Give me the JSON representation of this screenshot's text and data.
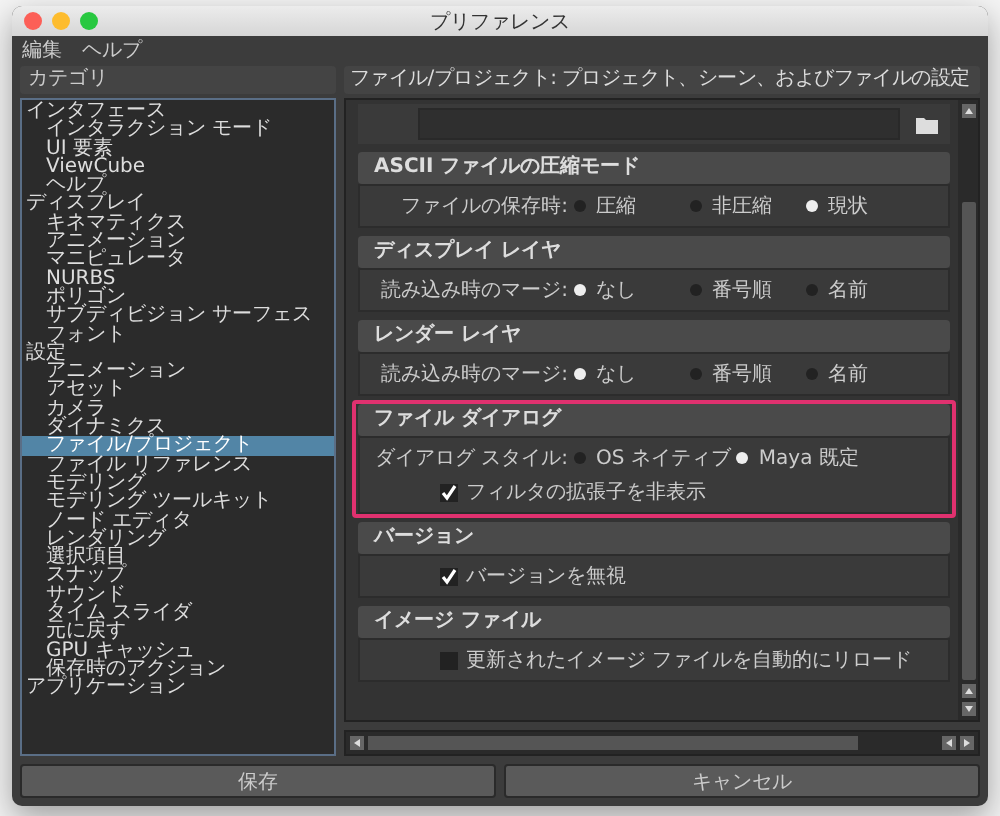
{
  "window": {
    "title": "プリファレンス"
  },
  "menu": [
    "編集",
    "ヘルプ"
  ],
  "categories_header": "カテゴリ",
  "categories": [
    {
      "label": "インタフェース",
      "selected": false,
      "children": [
        {
          "label": "インタラクション モード",
          "selected": false
        },
        {
          "label": "UI 要素",
          "selected": false
        },
        {
          "label": "ViewCube",
          "selected": false
        },
        {
          "label": "ヘルプ",
          "selected": false
        }
      ]
    },
    {
      "label": "ディスプレイ",
      "selected": false,
      "children": [
        {
          "label": "キネマティクス",
          "selected": false
        },
        {
          "label": "アニメーション",
          "selected": false
        },
        {
          "label": "マニピュレータ",
          "selected": false
        },
        {
          "label": "NURBS",
          "selected": false
        },
        {
          "label": "ポリゴン",
          "selected": false
        },
        {
          "label": "サブディビジョン サーフェス",
          "selected": false
        },
        {
          "label": "フォント",
          "selected": false
        }
      ]
    },
    {
      "label": "設定",
      "selected": false,
      "children": [
        {
          "label": "アニメーション",
          "selected": false
        },
        {
          "label": "アセット",
          "selected": false
        },
        {
          "label": "カメラ",
          "selected": false
        },
        {
          "label": "ダイナミクス",
          "selected": false
        },
        {
          "label": "ファイル/プロジェクト",
          "selected": true
        },
        {
          "label": "ファイル リファレンス",
          "selected": false
        },
        {
          "label": "モデリング",
          "selected": false
        },
        {
          "label": "モデリング ツールキット",
          "selected": false
        },
        {
          "label": "ノード エディタ",
          "selected": false
        },
        {
          "label": "レンダリング",
          "selected": false
        },
        {
          "label": "選択項目",
          "selected": false
        },
        {
          "label": "スナップ",
          "selected": false
        },
        {
          "label": "サウンド",
          "selected": false
        },
        {
          "label": "タイム スライダ",
          "selected": false
        },
        {
          "label": "元に戻す",
          "selected": false
        },
        {
          "label": "GPU キャッシュ",
          "selected": false
        },
        {
          "label": "保存時のアクション",
          "selected": false
        }
      ]
    },
    {
      "label": "アプリケーション",
      "selected": false
    }
  ],
  "panel_title": "ファイル/プロジェクト: プロジェクト、シーン、およびファイルの設定",
  "sections": [
    {
      "title": "ASCII ファイルの圧縮モード",
      "highlighted": false,
      "rows": [
        {
          "kind": "radio",
          "label": "ファイルの保存時:",
          "options": [
            {
              "label": "圧縮",
              "selected": false
            },
            {
              "label": "非圧縮",
              "selected": false
            },
            {
              "label": "現状",
              "selected": true
            }
          ]
        }
      ]
    },
    {
      "title": "ディスプレイ レイヤ",
      "highlighted": false,
      "rows": [
        {
          "kind": "radio",
          "label": "読み込み時のマージ:",
          "options": [
            {
              "label": "なし",
              "selected": true
            },
            {
              "label": "番号順",
              "selected": false
            },
            {
              "label": "名前",
              "selected": false
            }
          ]
        }
      ]
    },
    {
      "title": "レンダー レイヤ",
      "highlighted": false,
      "rows": [
        {
          "kind": "radio",
          "label": "読み込み時のマージ:",
          "options": [
            {
              "label": "なし",
              "selected": true
            },
            {
              "label": "番号順",
              "selected": false
            },
            {
              "label": "名前",
              "selected": false
            }
          ]
        }
      ]
    },
    {
      "title": "ファイル ダイアログ",
      "highlighted": true,
      "rows": [
        {
          "kind": "radio",
          "label": "ダイアログ スタイル:",
          "options": [
            {
              "label": "OS ネイティブ",
              "selected": false
            },
            {
              "label": "Maya 既定",
              "selected": true
            }
          ]
        },
        {
          "kind": "checkbox",
          "label": "フィルタの拡張子を非表示",
          "checked": true
        }
      ]
    },
    {
      "title": "バージョン",
      "highlighted": false,
      "rows": [
        {
          "kind": "checkbox",
          "label": "バージョンを無視",
          "checked": true
        }
      ]
    },
    {
      "title": "イメージ ファイル",
      "highlighted": false,
      "rows": [
        {
          "kind": "checkbox",
          "label": "更新されたイメージ ファイルを自動的にリロード",
          "checked": false
        }
      ]
    }
  ],
  "buttons": [
    "保存",
    "キャンセル"
  ]
}
